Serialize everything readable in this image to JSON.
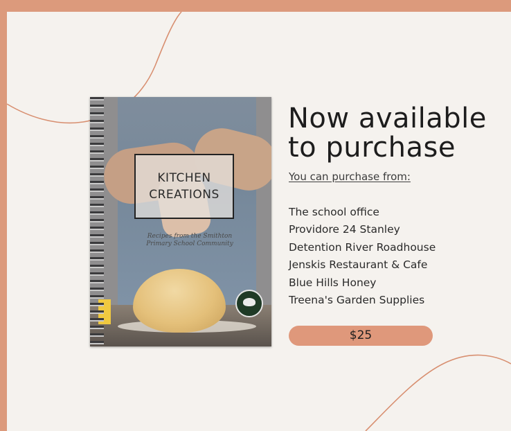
{
  "colors": {
    "frame": "#dc9a7c",
    "background": "#f5f2ee",
    "accent_pill": "#df987b",
    "text": "#1d1d1d"
  },
  "book_cover": {
    "title_line1": "KITCHEN",
    "title_line2": "CREATIONS",
    "subtitle": "Recipes from the Smithton Primary School Community"
  },
  "headline": {
    "line1": "Now available",
    "line2": "to purchase"
  },
  "purchase_from_label": "You can purchase from:",
  "stores": [
    "The school office",
    "Providore 24 Stanley",
    "Detention River Roadhouse",
    "Jenskis Restaurant & Cafe",
    "Blue Hills Honey",
    "Treena's Garden Supplies"
  ],
  "price": "$25",
  "icons": {
    "badge": "school-logo-icon"
  }
}
